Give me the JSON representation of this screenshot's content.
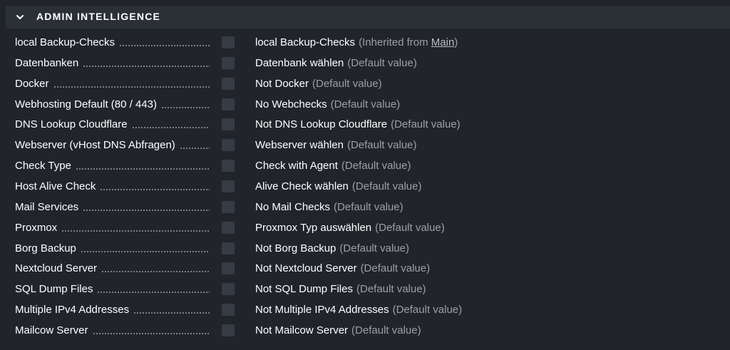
{
  "section": {
    "title": "ADMIN INTELLIGENCE",
    "icon": "chevron-down-icon"
  },
  "rows": [
    {
      "label": "local Backup-Checks",
      "value": "local Backup-Checks",
      "hint_prefix": "(Inherited from ",
      "hint_link": "Main",
      "hint_suffix": ")"
    },
    {
      "label": "Datenbanken",
      "value": "Datenbank wählen",
      "hint": "(Default value)"
    },
    {
      "label": "Docker",
      "value": "Not Docker",
      "hint": "(Default value)"
    },
    {
      "label": "Webhosting Default (80 / 443)",
      "value": "No Webchecks",
      "hint": "(Default value)"
    },
    {
      "label": "DNS Lookup Cloudflare",
      "value": "Not DNS Lookup Cloudflare",
      "hint": "(Default value)"
    },
    {
      "label": "Webserver (vHost DNS Abfragen)",
      "value": "Webserver wählen",
      "hint": "(Default value)"
    },
    {
      "label": "Check Type",
      "value": "Check with Agent",
      "hint": "(Default value)"
    },
    {
      "label": "Host Alive Check",
      "value": "Alive Check wählen",
      "hint": "(Default value)"
    },
    {
      "label": "Mail Services",
      "value": "No Mail Checks",
      "hint": "(Default value)"
    },
    {
      "label": "Proxmox",
      "value": "Proxmox Typ auswählen",
      "hint": "(Default value)"
    },
    {
      "label": "Borg Backup",
      "value": "Not Borg Backup",
      "hint": "(Default value)"
    },
    {
      "label": "Nextcloud Server",
      "value": "Not Nextcloud Server",
      "hint": "(Default value)"
    },
    {
      "label": "SQL Dump Files",
      "value": "Not SQL Dump Files",
      "hint": "(Default value)"
    },
    {
      "label": "Multiple IPv4 Addresses",
      "value": "Not Multiple IPv4 Addresses",
      "hint": "(Default value)"
    },
    {
      "label": "Mailcow Server",
      "value": "Not Mailcow Server",
      "hint": "(Default value)"
    }
  ],
  "colors": {
    "background": "#21252b",
    "header_background": "#2b3037",
    "checkbox": "#363c44",
    "text": "#ffffff",
    "hint_text": "#9aa0a6"
  }
}
